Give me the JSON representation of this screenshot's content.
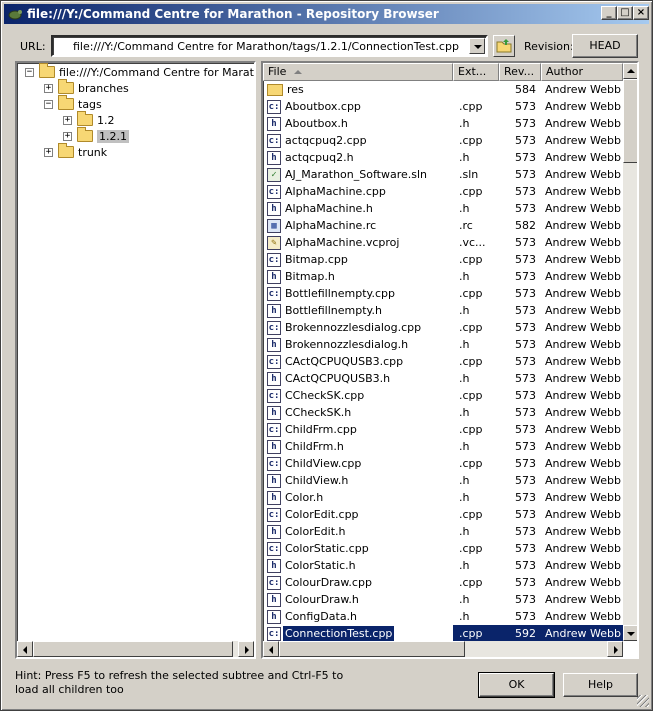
{
  "window": {
    "title": "file:///Y:/Command Centre for Marathon - Repository Browser",
    "min_glyph": "_",
    "max_glyph": "□",
    "close_glyph": "×"
  },
  "url_bar": {
    "label": "URL:",
    "value": "file:///Y:/Command Centre for Marathon/tags/1.2.1/ConnectionTest.cpp",
    "revision_label": "Revision:",
    "revision_button": "HEAD"
  },
  "tree": {
    "nodes": [
      {
        "label": "file:///Y:/Command Centre for Marathon",
        "expander": "−"
      },
      {
        "label": "branches",
        "expander": "+"
      },
      {
        "label": "tags",
        "expander": "−"
      },
      {
        "label": "1.2",
        "expander": "+"
      },
      {
        "label": "1.2.1",
        "expander": "+"
      },
      {
        "label": "trunk",
        "expander": "+"
      }
    ]
  },
  "list": {
    "columns": [
      "File",
      "Ext...",
      "Rev...",
      "Author"
    ],
    "rows": [
      {
        "icon": "folder",
        "name": "res",
        "ext": "",
        "rev": "584",
        "author": "Andrew Webb"
      },
      {
        "icon": "cpp",
        "name": "Aboutbox.cpp",
        "ext": ".cpp",
        "rev": "573",
        "author": "Andrew Webb"
      },
      {
        "icon": "h",
        "name": "Aboutbox.h",
        "ext": ".h",
        "rev": "573",
        "author": "Andrew Webb"
      },
      {
        "icon": "cpp",
        "name": "actqcpuq2.cpp",
        "ext": ".cpp",
        "rev": "573",
        "author": "Andrew Webb"
      },
      {
        "icon": "h",
        "name": "actqcpuq2.h",
        "ext": ".h",
        "rev": "573",
        "author": "Andrew Webb"
      },
      {
        "icon": "sln",
        "name": "AJ_Marathon_Software.sln",
        "ext": ".sln",
        "rev": "573",
        "author": "Andrew Webb"
      },
      {
        "icon": "cpp",
        "name": "AlphaMachine.cpp",
        "ext": ".cpp",
        "rev": "573",
        "author": "Andrew Webb"
      },
      {
        "icon": "h",
        "name": "AlphaMachine.h",
        "ext": ".h",
        "rev": "573",
        "author": "Andrew Webb"
      },
      {
        "icon": "rc",
        "name": "AlphaMachine.rc",
        "ext": ".rc",
        "rev": "582",
        "author": "Andrew Webb"
      },
      {
        "icon": "vc",
        "name": "AlphaMachine.vcproj",
        "ext": ".vc...",
        "rev": "573",
        "author": "Andrew Webb"
      },
      {
        "icon": "cpp",
        "name": "Bitmap.cpp",
        "ext": ".cpp",
        "rev": "573",
        "author": "Andrew Webb"
      },
      {
        "icon": "h",
        "name": "Bitmap.h",
        "ext": ".h",
        "rev": "573",
        "author": "Andrew Webb"
      },
      {
        "icon": "cpp",
        "name": "Bottlefillnempty.cpp",
        "ext": ".cpp",
        "rev": "573",
        "author": "Andrew Webb"
      },
      {
        "icon": "h",
        "name": "Bottlefillnempty.h",
        "ext": ".h",
        "rev": "573",
        "author": "Andrew Webb"
      },
      {
        "icon": "cpp",
        "name": "Brokennozzlesdialog.cpp",
        "ext": ".cpp",
        "rev": "573",
        "author": "Andrew Webb"
      },
      {
        "icon": "h",
        "name": "Brokennozzlesdialog.h",
        "ext": ".h",
        "rev": "573",
        "author": "Andrew Webb"
      },
      {
        "icon": "cpp",
        "name": "CActQCPUQUSB3.cpp",
        "ext": ".cpp",
        "rev": "573",
        "author": "Andrew Webb"
      },
      {
        "icon": "h",
        "name": "CActQCPUQUSB3.h",
        "ext": ".h",
        "rev": "573",
        "author": "Andrew Webb"
      },
      {
        "icon": "cpp",
        "name": "CCheckSK.cpp",
        "ext": ".cpp",
        "rev": "573",
        "author": "Andrew Webb"
      },
      {
        "icon": "h",
        "name": "CCheckSK.h",
        "ext": ".h",
        "rev": "573",
        "author": "Andrew Webb"
      },
      {
        "icon": "cpp",
        "name": "ChildFrm.cpp",
        "ext": ".cpp",
        "rev": "573",
        "author": "Andrew Webb"
      },
      {
        "icon": "h",
        "name": "ChildFrm.h",
        "ext": ".h",
        "rev": "573",
        "author": "Andrew Webb"
      },
      {
        "icon": "cpp",
        "name": "ChildView.cpp",
        "ext": ".cpp",
        "rev": "573",
        "author": "Andrew Webb"
      },
      {
        "icon": "h",
        "name": "ChildView.h",
        "ext": ".h",
        "rev": "573",
        "author": "Andrew Webb"
      },
      {
        "icon": "h",
        "name": "Color.h",
        "ext": ".h",
        "rev": "573",
        "author": "Andrew Webb"
      },
      {
        "icon": "cpp",
        "name": "ColorEdit.cpp",
        "ext": ".cpp",
        "rev": "573",
        "author": "Andrew Webb"
      },
      {
        "icon": "h",
        "name": "ColorEdit.h",
        "ext": ".h",
        "rev": "573",
        "author": "Andrew Webb"
      },
      {
        "icon": "cpp",
        "name": "ColorStatic.cpp",
        "ext": ".cpp",
        "rev": "573",
        "author": "Andrew Webb"
      },
      {
        "icon": "h",
        "name": "ColorStatic.h",
        "ext": ".h",
        "rev": "573",
        "author": "Andrew Webb"
      },
      {
        "icon": "cpp",
        "name": "ColourDraw.cpp",
        "ext": ".cpp",
        "rev": "573",
        "author": "Andrew Webb"
      },
      {
        "icon": "h",
        "name": "ColourDraw.h",
        "ext": ".h",
        "rev": "573",
        "author": "Andrew Webb"
      },
      {
        "icon": "h",
        "name": "ConfigData.h",
        "ext": ".h",
        "rev": "573",
        "author": "Andrew Webb"
      },
      {
        "icon": "cpp",
        "name": "ConnectionTest.cpp",
        "ext": ".cpp",
        "rev": "592",
        "author": "Andrew Webb",
        "selected": true
      }
    ]
  },
  "footer": {
    "hint": "Hint: Press F5 to refresh the selected subtree and Ctrl-F5 to load all children too",
    "ok": "OK",
    "help": "Help"
  },
  "colors": {
    "titlebar_start": "#0a246a",
    "titlebar_end": "#a6caf0",
    "selection": "#0a246a",
    "face": "#d4d0c8"
  }
}
